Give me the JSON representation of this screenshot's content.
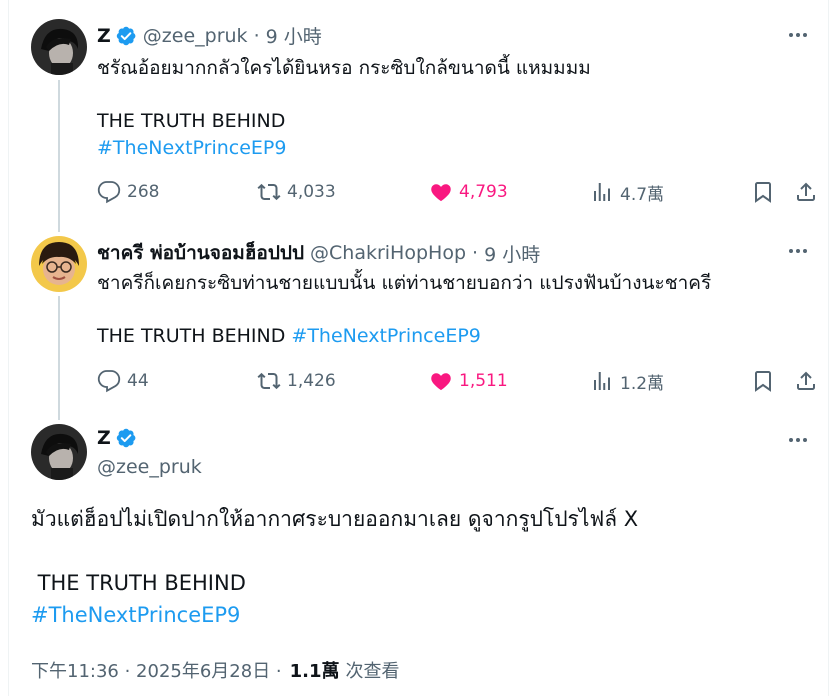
{
  "tweet1": {
    "name": "Z",
    "handle": "@zee_pruk",
    "separator": "·",
    "time": "9 小時",
    "line1": "ชรัณอ้อยมากกลัวใครได้ยินหรอ กระซิบใกล้ขนาดนี้ แหมมมม",
    "line2": "THE TRUTH BEHIND",
    "hashtag": "#TheNextPrinceEP9",
    "replies": "268",
    "reposts": "4,033",
    "likes": "4,793",
    "views": "4.7萬"
  },
  "tweet2": {
    "name": "ชาครี พ่อบ้านจอมฮ็อปปป",
    "handle": "@ChakriHopHop",
    "separator": "·",
    "time": "9 小時",
    "line1": "ชาครีก็เคยกระซิบท่านชายแบบนั้น แต่ท่านชายบอกว่า แปรงฟันบ้างนะชาครี",
    "line2": "THE TRUTH BEHIND",
    "hashtag": "#TheNextPrinceEP9",
    "replies": "44",
    "reposts": "1,426",
    "likes": "1,511",
    "views": "1.2萬"
  },
  "tweet3": {
    "name": "Z",
    "handle": "@zee_pruk",
    "line1": "มัวแต่ฮ็อปไม่เปิดปากให้อากาศระบายออกมาเลย ดูจากรูปโปรไฟล์ X",
    "line2": " THE TRUTH BEHIND",
    "hashtag": "#TheNextPrinceEP9",
    "timestamp": "下午11:36 · 2025年6月28日 ·",
    "views_count": "1.1萬",
    "views_label": "次查看"
  },
  "colors": {
    "accent": "#1d9bf0",
    "like": "#f91880",
    "muted": "#536471",
    "text": "#0f1419"
  }
}
